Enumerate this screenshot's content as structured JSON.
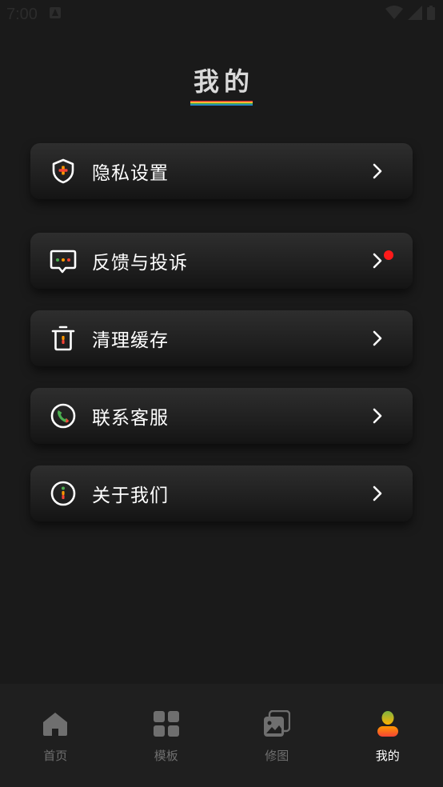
{
  "status_bar": {
    "time": "7:00"
  },
  "page": {
    "title": "我的"
  },
  "menu": [
    {
      "label": "隐私设置",
      "icon": "shield-plus-icon",
      "badge": false
    },
    {
      "label": "反馈与投诉",
      "icon": "chat-bubble-icon",
      "badge": true
    },
    {
      "label": "清理缓存",
      "icon": "trash-icon",
      "badge": false
    },
    {
      "label": "联系客服",
      "icon": "phone-icon",
      "badge": false
    },
    {
      "label": "关于我们",
      "icon": "info-icon",
      "badge": false
    }
  ],
  "tabs": [
    {
      "label": "首页",
      "icon": "home-icon",
      "active": false
    },
    {
      "label": "模板",
      "icon": "grid-icon",
      "active": false
    },
    {
      "label": "修图",
      "icon": "photo-edit-icon",
      "active": false
    },
    {
      "label": "我的",
      "icon": "user-icon",
      "active": true
    }
  ],
  "colors": {
    "background": "#1a1a1a",
    "badge": "#ff1a1a",
    "tab_inactive": "#6f6f6f",
    "tab_active": "#ffffff"
  }
}
